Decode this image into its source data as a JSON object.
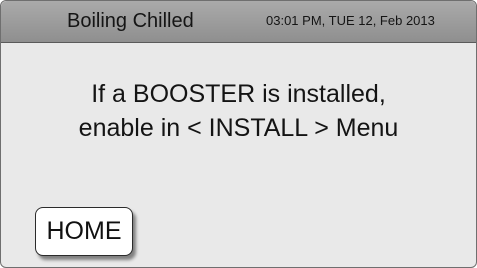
{
  "header": {
    "mode_title": "Boiling Chilled",
    "datetime": "03:01 PM, TUE 12, Feb 2013"
  },
  "message": {
    "line1": "If a BOOSTER is installed,",
    "line2": "enable in < INSTALL > Menu"
  },
  "footer": {
    "home_label": "HOME"
  }
}
